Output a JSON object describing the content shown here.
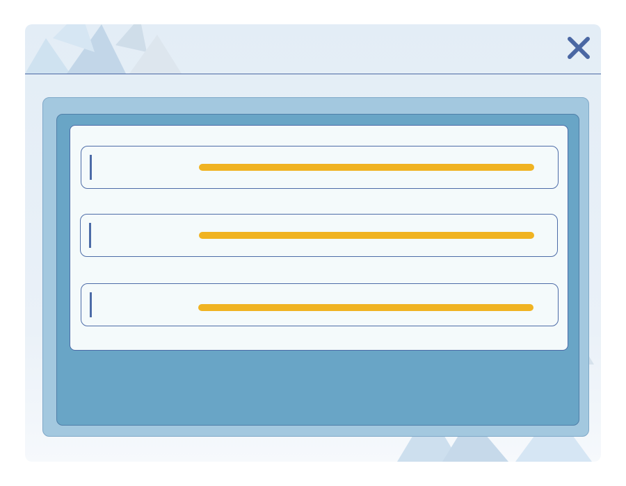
{
  "dialog": {
    "close_icon": "close-icon",
    "accent_color": "#4a67a3",
    "highlight_color": "#f0b322"
  },
  "form": {
    "fields": [
      {
        "label": "",
        "value": ""
      },
      {
        "label": "",
        "value": ""
      },
      {
        "label": "",
        "value": ""
      }
    ]
  }
}
